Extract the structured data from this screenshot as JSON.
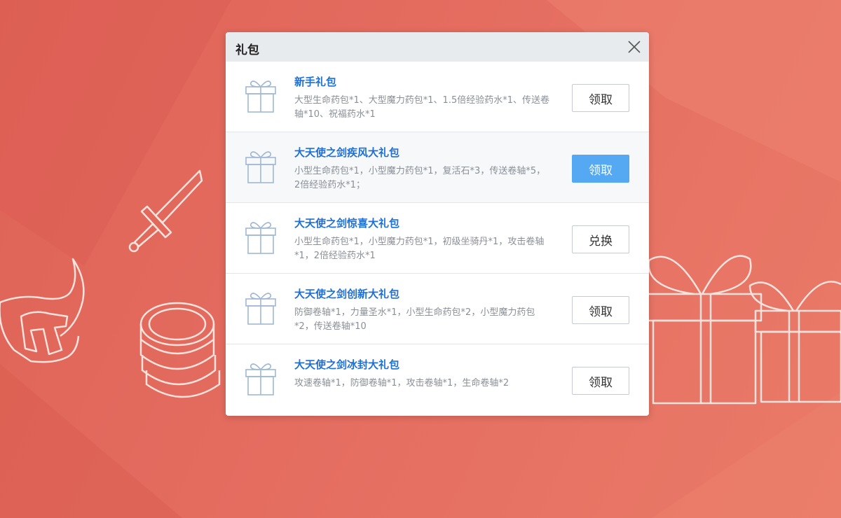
{
  "dialog": {
    "title": "礼包",
    "close_icon": "close-icon"
  },
  "packs": [
    {
      "name": "新手礼包",
      "desc": "大型生命药包*1、大型魔力药包*1、1.5倍经验药水*1、传送卷轴*10、祝福药水*1",
      "button": "领取",
      "state": "normal"
    },
    {
      "name": "大天使之剑疾风大礼包",
      "desc": "小型生命药包*1，小型魔力药包*1，复活石*3，传送卷轴*5，2倍经验药水*1；",
      "button": "领取",
      "state": "active"
    },
    {
      "name": "大天使之剑惊喜大礼包",
      "desc": "小型生命药包*1，小型魔力药包*1，初级坐骑丹*1，攻击卷轴*1，2倍经验药水*1",
      "button": "兑换",
      "state": "normal"
    },
    {
      "name": "大天使之剑创新大礼包",
      "desc": "防御卷轴*1，力量圣水*1，小型生命药包*2，小型魔力药包*2，传送卷轴*10",
      "button": "领取",
      "state": "normal"
    },
    {
      "name": "大天使之剑冰封大礼包",
      "desc": "攻速卷轴*1，防御卷轴*1，攻击卷轴*1，生命卷轴*2",
      "button": "领取",
      "state": "normal"
    }
  ],
  "colors": {
    "background": "#e46d60",
    "title_link": "#1e6fd6",
    "active_button": "#55a9f3"
  },
  "decorations": [
    "sword-icon",
    "helmet-icon",
    "coin-stack-icon",
    "gift-box-icon"
  ]
}
